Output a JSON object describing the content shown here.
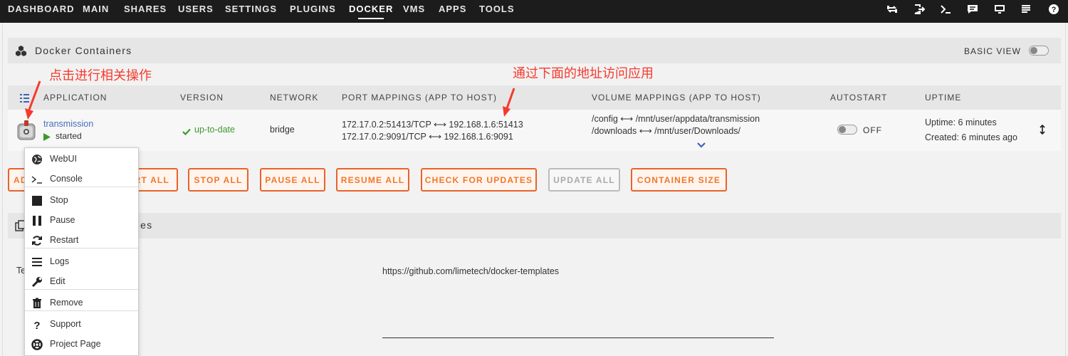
{
  "nav": {
    "items": [
      "DASHBOARD",
      "MAIN",
      "SHARES",
      "USERS",
      "SETTINGS",
      "PLUGINS",
      "DOCKER",
      "VMS",
      "APPS",
      "TOOLS"
    ],
    "icons": [
      "sync-icon",
      "logout-icon",
      "terminal-icon",
      "feedback-icon",
      "monitor-icon",
      "log-icon",
      "help-icon"
    ]
  },
  "docker_section": {
    "title": "Docker Containers",
    "basic_view_label": "BASIC VIEW"
  },
  "table": {
    "headers": {
      "application": "APPLICATION",
      "version": "VERSION",
      "network": "NETWORK",
      "ports": "PORT MAPPINGS (APP TO HOST)",
      "volumes": "VOLUME MAPPINGS (APP TO HOST)",
      "autostart": "AUTOSTART",
      "uptime": "UPTIME"
    },
    "row": {
      "name": "transmission",
      "state": "started",
      "version": "up-to-date",
      "network": "bridge",
      "port1": "172.17.0.2:51413/TCP ⟷ 192.168.1.6:51413",
      "port2": "172.17.0.2:9091/TCP ⟷ 192.168.1.6:9091",
      "vol1": "/config ⟷ /mnt/user/appdata/transmission",
      "vol2": "/downloads ⟷ /mnt/user/Downloads/",
      "autostart": "OFF",
      "uptime": "Uptime: 6 minutes",
      "created": "Created: 6 minutes ago"
    }
  },
  "buttons": {
    "add": "AD",
    "start_all": "RT ALL",
    "stop_all": "STOP ALL",
    "pause_all": "PAUSE ALL",
    "resume_all": "RESUME ALL",
    "check_updates": "CHECK FOR UPDATES",
    "update_all": "UPDATE ALL",
    "container_size": "CONTAINER SIZE"
  },
  "repo_section": {
    "title_fragment": "ries",
    "row_label_fragment": "Te",
    "url": "https://github.com/limetech/docker-templates"
  },
  "context_menu": {
    "webui": "WebUI",
    "console": "Console",
    "stop": "Stop",
    "pause": "Pause",
    "restart": "Restart",
    "logs": "Logs",
    "edit": "Edit",
    "remove": "Remove",
    "support": "Support",
    "project_page": "Project Page"
  },
  "annotations": {
    "click_hint": "点击进行相关操作",
    "address_hint": "通过下面的地址访问应用"
  },
  "colors": {
    "accent_orange": "#f0772e",
    "annotation_red": "#f53a2f",
    "link_blue": "#486dba",
    "status_green": "#3c9a2c"
  }
}
